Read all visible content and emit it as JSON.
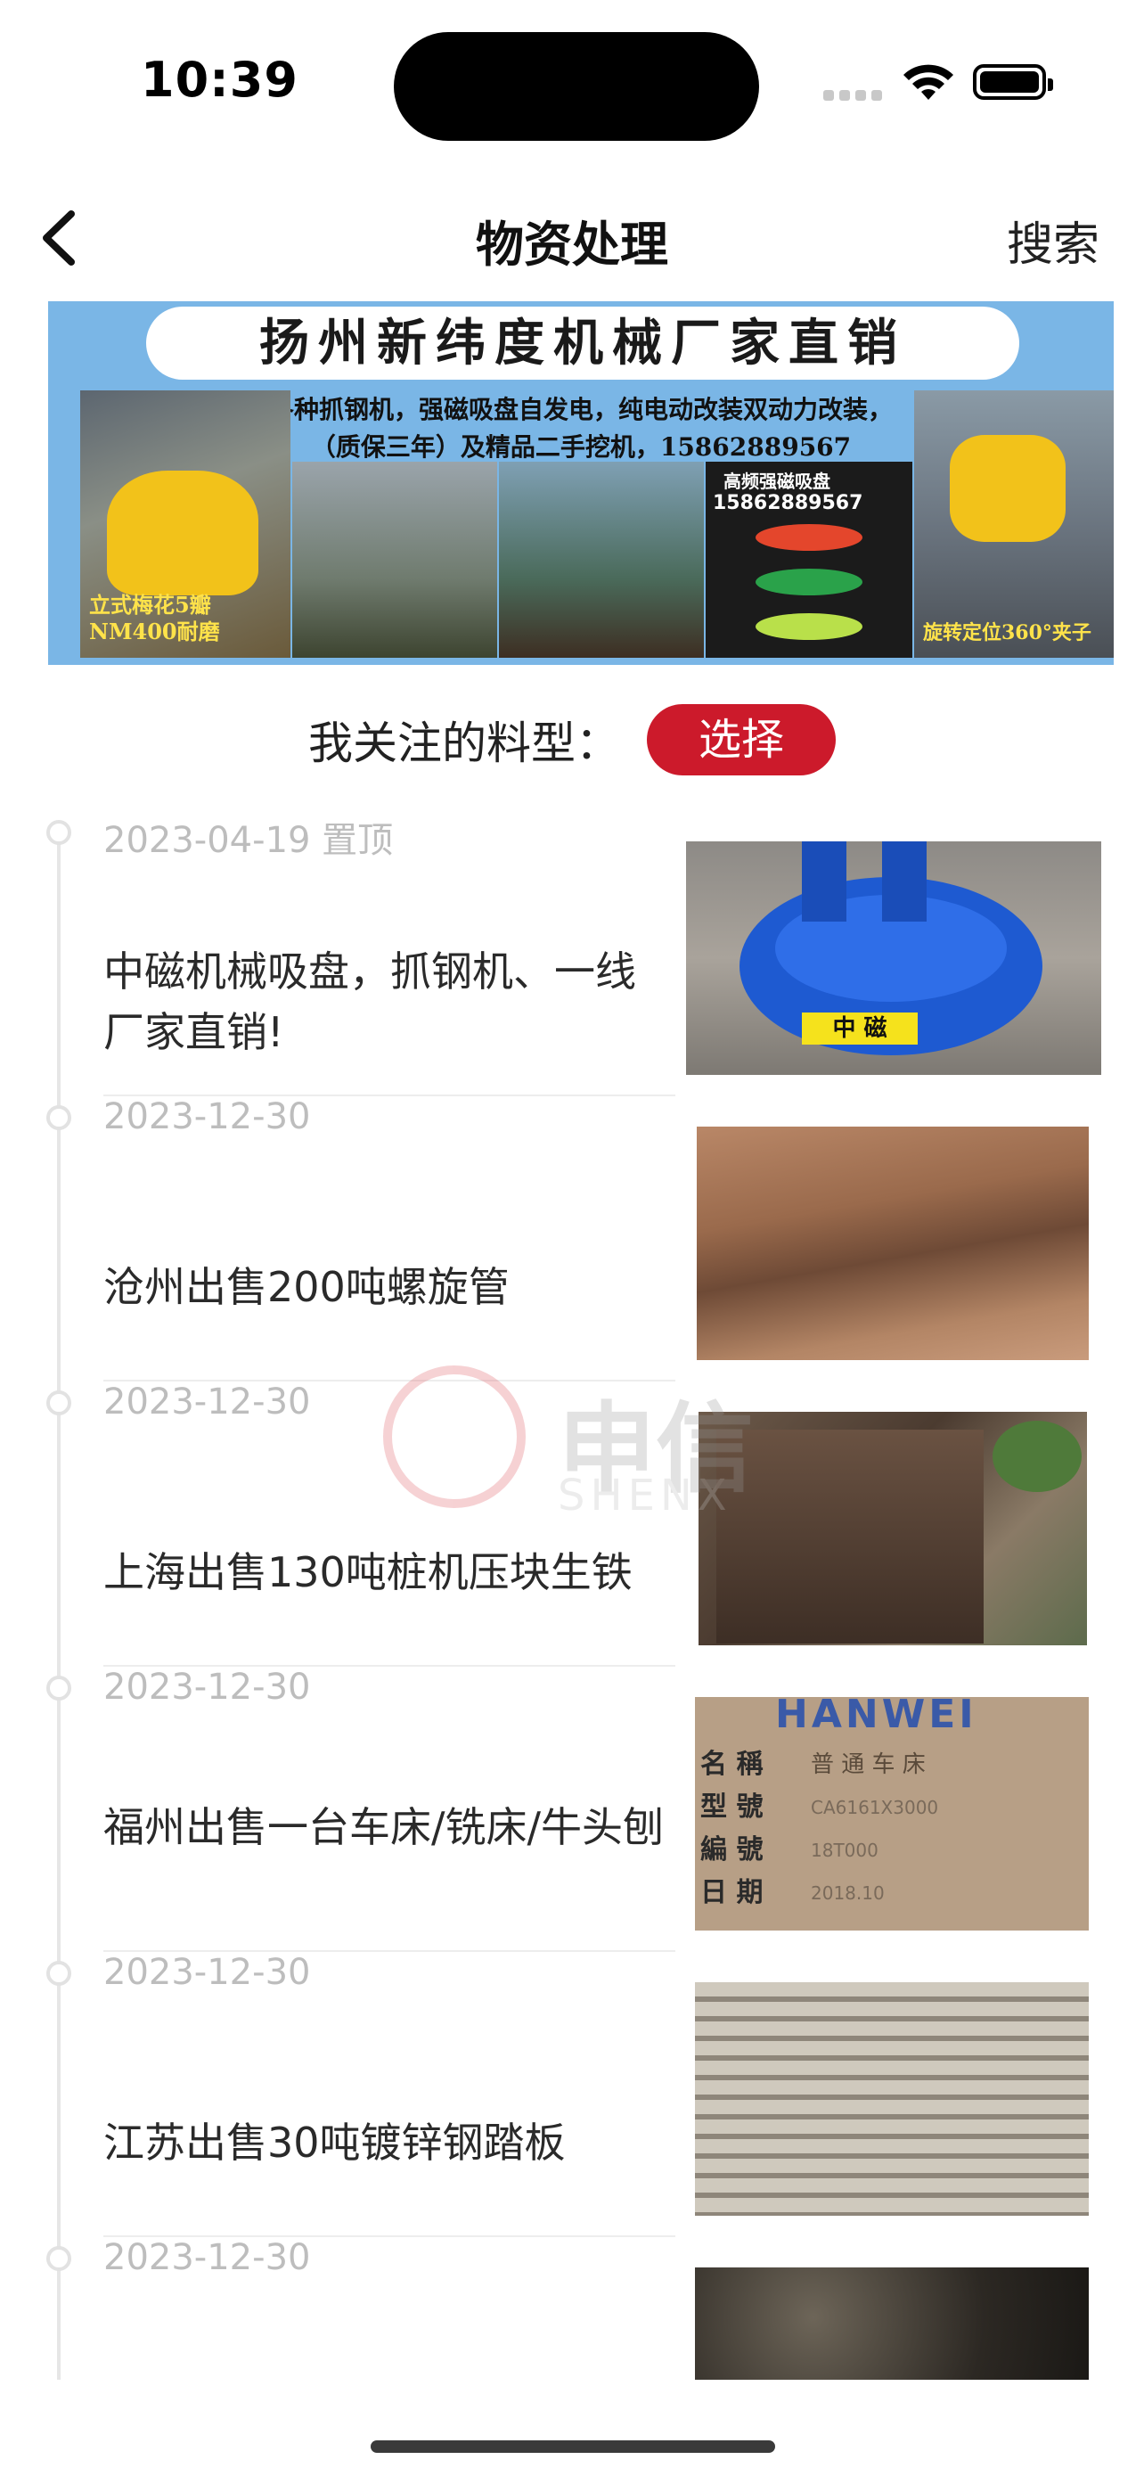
{
  "status": {
    "time": "10:39"
  },
  "nav": {
    "title": "物资处理",
    "search": "搜索"
  },
  "banner": {
    "headline": "扬州新纬度机械厂家直销",
    "line1": "各种抓钢机，强磁吸盘自发电，纯电动改装双动力改装，",
    "line2": "（质保三年）及精品二手挖机，15862889567",
    "caption_left": "立式梅花5瓣 NM400耐磨",
    "caption_right": "旋转定位360°夹子",
    "caption_magnet": "高频强磁吸盘",
    "phone": "15862889567"
  },
  "follow": {
    "label": "我关注的料型：",
    "button": "选择"
  },
  "items": [
    {
      "date": "2023-04-19 置顶",
      "title": "中磁机械吸盘，抓钢机、一线厂家直销!"
    },
    {
      "date": "2023-12-30",
      "title": "沧州出售200吨螺旋管"
    },
    {
      "date": "2023-12-30",
      "title": "上海出售130吨桩机压块生铁"
    },
    {
      "date": "2023-12-30",
      "title": "福州出售一台车床/铣床/牛头刨"
    },
    {
      "date": "2023-12-30",
      "title": "江苏出售30吨镀锌钢踏板"
    },
    {
      "date": "2023-12-30",
      "title": ""
    }
  ],
  "thumb_labels": {
    "magnet": "中 磁",
    "nameplate_brand": "HANWEI",
    "nameplate_rows": [
      "名 稱",
      "型 號",
      "編 號",
      "日 期"
    ],
    "nameplate_vals": [
      "普 通 车 床",
      "CA6161X3000",
      "18T000",
      "2018.10"
    ]
  },
  "watermark": {
    "text": "申信",
    "sub": "SHENX"
  }
}
